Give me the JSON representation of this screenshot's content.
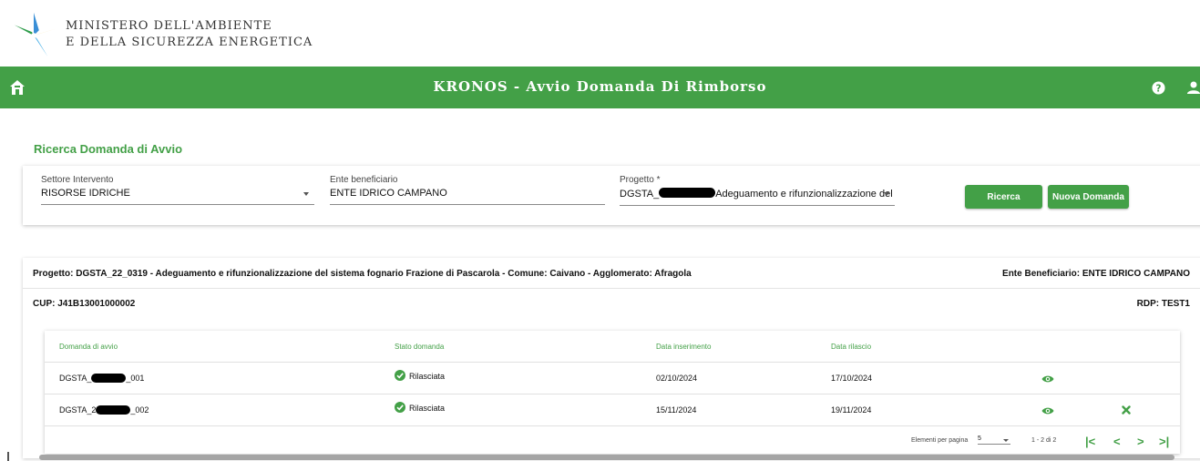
{
  "header": {
    "ministry_line1": "MINISTERO DELL'AMBIENTE",
    "ministry_line2": "E DELLA SICUREZZA ENERGETICA",
    "app_title": "KRONOS - Avvio Domanda Di Rimborso",
    "accent_color": "#43a047",
    "icons": [
      "home-icon",
      "help-icon",
      "user-icon"
    ]
  },
  "search": {
    "title": "Ricerca Domanda di Avvio",
    "settore_label": "Settore Intervento",
    "settore_value": "RISORSE IDRICHE",
    "ente_label": "Ente beneficiario",
    "ente_value": "ENTE IDRICO CAMPANO",
    "progetto_label": "Progetto *",
    "progetto_prefix": "DGSTA_",
    "progetto_suffix": "Adeguamento e rifunzionalizzazione del ...",
    "ricerca_button": "Ricerca",
    "nuova_button": "Nuova Domanda"
  },
  "project": {
    "progetto_label": "Progetto:",
    "progetto_value": "DGSTA_22_0319 - Adeguamento e rifunzionalizzazione del sistema fognario Frazione di Pascarola - Comune: Caivano - Agglomerato: Afragola",
    "ente_label": "Ente Beneficiario:",
    "ente_value": "ENTE IDRICO CAMPANO",
    "cup_label": "CUP:",
    "cup_value": "J41B13001000002",
    "rdp_label": "RDP:",
    "rdp_value": "TEST1"
  },
  "table": {
    "columns": [
      "Domanda di avvio",
      "Stato domanda",
      "Data inserimento",
      "Data rilascio"
    ],
    "rows": [
      {
        "domanda_prefix": "DGSTA_",
        "domanda_suffix": "_001",
        "stato": "Rilasciata",
        "data_inserimento": "02/10/2024",
        "data_rilascio": "17/10/2024",
        "actions": [
          "eye-icon"
        ]
      },
      {
        "domanda_prefix": "DGSTA_2",
        "domanda_suffix": "_002",
        "stato": "Rilasciata",
        "data_inserimento": "15/11/2024",
        "data_rilascio": "19/11/2024",
        "actions": [
          "eye-icon",
          "close-icon"
        ]
      }
    ]
  },
  "pager": {
    "per_page_label": "Elementi per pagina",
    "per_page_value": "5",
    "range": "1 - 2 di 2",
    "first": "|<",
    "prev": "<",
    "next": ">",
    "last": ">|"
  }
}
